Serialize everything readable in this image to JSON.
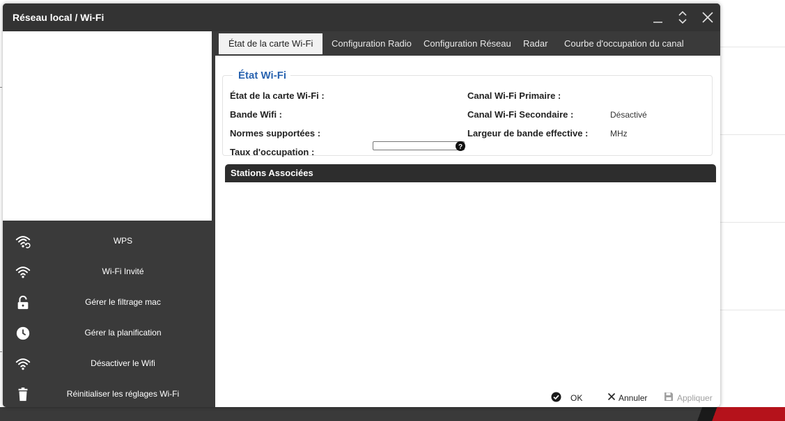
{
  "window": {
    "title": "Réseau local / Wi-Fi"
  },
  "tabs": [
    {
      "label": "État de la carte Wi-Fi",
      "active": true
    },
    {
      "label": "Configuration Radio",
      "active": false
    },
    {
      "label": "Configuration Réseau",
      "active": false
    },
    {
      "label": "Radar",
      "active": false
    },
    {
      "label": "Courbe d'occupation du canal",
      "active": false
    }
  ],
  "wifi_status": {
    "legend": "État Wi-Fi",
    "card_state_label": "État de la carte Wi-Fi :",
    "band_label": "Bande Wifi :",
    "norms_label": "Normes supportées :",
    "occupancy_label": "Taux d'occupation :",
    "primary_channel_label": "Canal Wi-Fi Primaire :",
    "secondary_channel_label": "Canal Wi-Fi Secondaire :",
    "secondary_channel_value": "Désactivé",
    "bandwidth_label": "Largeur de bande effective :",
    "bandwidth_value": "MHz",
    "occupancy_fraction": 0
  },
  "stations": {
    "title": "Stations Associées"
  },
  "menu": [
    {
      "label": "WPS",
      "icon": "wps-icon"
    },
    {
      "label": "Wi-Fi Invité",
      "icon": "wifi-icon"
    },
    {
      "label": "Gérer le filtrage mac",
      "icon": "lock-icon"
    },
    {
      "label": "Gérer la planification",
      "icon": "clock-icon"
    },
    {
      "label": "Désactiver le Wifi",
      "icon": "wifi-icon"
    },
    {
      "label": "Réinitialiser les réglages Wi-Fi",
      "icon": "trash-icon"
    }
  ],
  "footer": {
    "ok_label": "OK",
    "cancel_label": "Annuler",
    "apply_label": "Appliquer"
  },
  "colors": {
    "accent": "#2a64b0",
    "dark_panel": "#3a3a3a",
    "disabled": "#a0a0a0"
  }
}
